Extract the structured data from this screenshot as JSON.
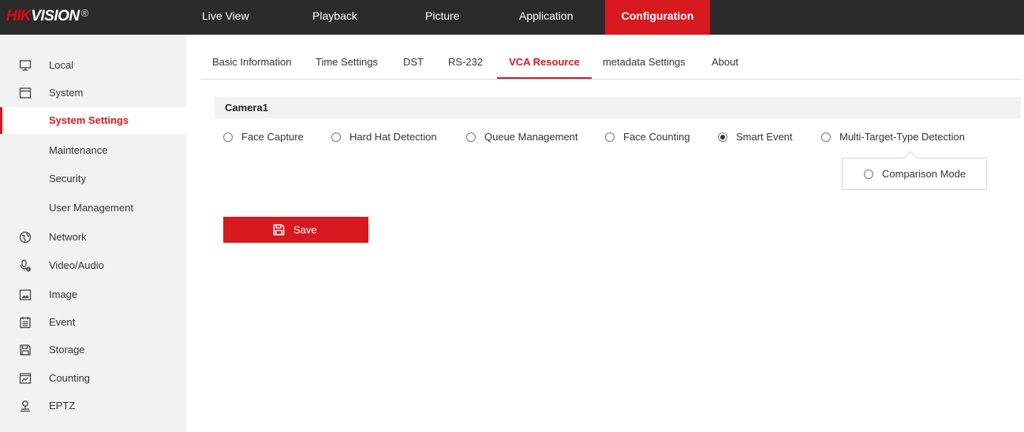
{
  "brand": {
    "logo_red": "HIK",
    "logo_white": "VISION",
    "logo_mark": "®"
  },
  "top_nav": [
    {
      "label": "Live View"
    },
    {
      "label": "Playback"
    },
    {
      "label": "Picture"
    },
    {
      "label": "Application"
    },
    {
      "label": "Configuration",
      "active": true
    }
  ],
  "sidebar": {
    "items": [
      {
        "label": "Local",
        "icon": "monitor-icon"
      },
      {
        "label": "System",
        "icon": "window-icon"
      },
      {
        "label": "System Settings",
        "active": true
      },
      {
        "label": "Maintenance"
      },
      {
        "label": "Security"
      },
      {
        "label": "User Management"
      },
      {
        "label": "Network",
        "icon": "globe-icon"
      },
      {
        "label": "Video/Audio",
        "icon": "microphone-icon"
      },
      {
        "label": "Image",
        "icon": "image-icon"
      },
      {
        "label": "Event",
        "icon": "calendar-icon"
      },
      {
        "label": "Storage",
        "icon": "floppy-icon"
      },
      {
        "label": "Counting",
        "icon": "chart-icon"
      },
      {
        "label": "EPTZ",
        "icon": "person-icon"
      }
    ]
  },
  "subtabs": [
    {
      "label": "Basic Information"
    },
    {
      "label": "Time Settings"
    },
    {
      "label": "DST"
    },
    {
      "label": "RS-232"
    },
    {
      "label": "VCA Resource",
      "active": true
    },
    {
      "label": "metadata Settings"
    },
    {
      "label": "About"
    }
  ],
  "camera": {
    "title": "Camera1",
    "options": [
      {
        "label": "Face Capture",
        "checked": false
      },
      {
        "label": "Hard Hat Detection",
        "checked": false
      },
      {
        "label": "Queue Management",
        "checked": false
      },
      {
        "label": "Face Counting",
        "checked": false
      },
      {
        "label": "Smart Event",
        "checked": true
      },
      {
        "label": "Multi-Target-Type Detection",
        "checked": false
      }
    ],
    "sub_option": {
      "label": "Comparison Mode",
      "checked": false
    }
  },
  "save": {
    "label": "Save",
    "icon": "save-icon"
  },
  "colors": {
    "accent": "#d71920",
    "topbar": "#2b2b2b",
    "sidebar_bg": "#f2f2f2"
  }
}
